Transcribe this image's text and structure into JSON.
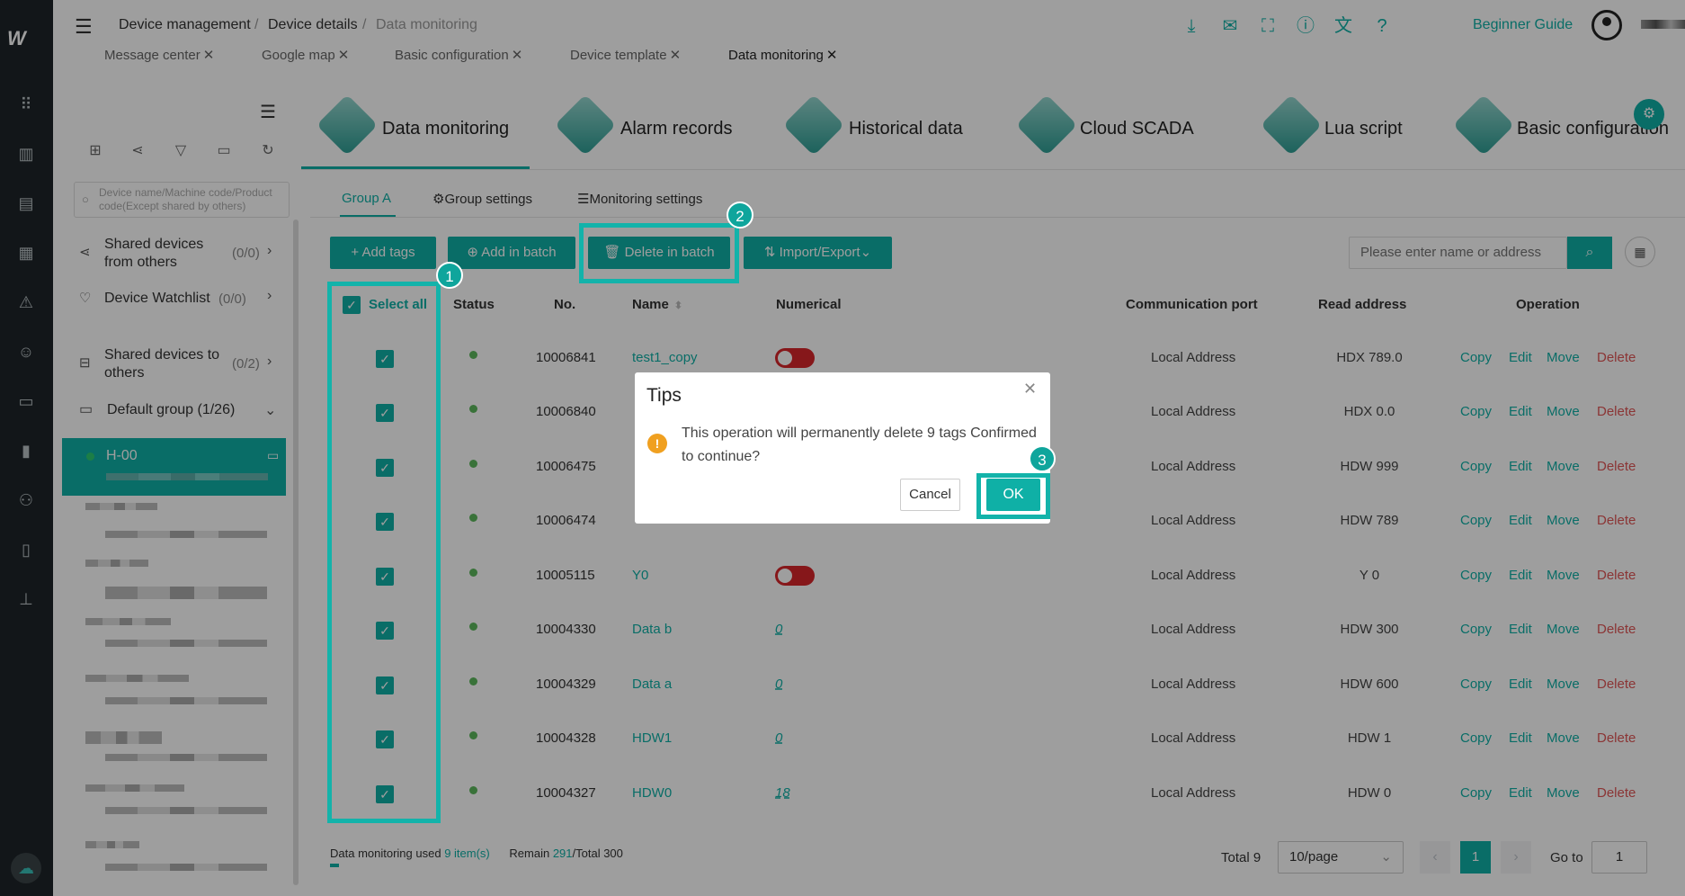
{
  "rail": {
    "logo": "W"
  },
  "breadcrumb": [
    "Device management",
    "Device details",
    "Data monitoring"
  ],
  "open_tabs": [
    "Message center",
    "Google map",
    "Basic configuration",
    "Device template",
    "Data monitoring"
  ],
  "header": {
    "guide": "Beginner Guide"
  },
  "sidebar": {
    "search_placeholder": "Device name/Machine code/Product code(Except shared by others)",
    "shared_from_label": "Shared devices from others",
    "shared_from_count": "(0/0)",
    "watchlist_label": "Device Watchlist",
    "watchlist_count": "(0/0)",
    "shared_to_label": "Shared devices to others",
    "shared_to_count": "(0/2)",
    "default_group": "Default group (1/26)",
    "selected_device": "H-00"
  },
  "main_tabs": [
    "Data monitoring",
    "Alarm records",
    "Historical data",
    "Cloud SCADA",
    "Lua script",
    "Basic configuration"
  ],
  "group_tabs": [
    "Group A",
    "Group settings",
    "Monitoring settings"
  ],
  "toolbar": {
    "add_tags": "Add tags",
    "add_batch": "Add in batch",
    "delete_batch": "Delete in batch",
    "import_export": "Import/Export",
    "search_placeholder": "Please enter name or address"
  },
  "table": {
    "select_all": "Select all",
    "headers": [
      "Status",
      "No.",
      "Name",
      "Numerical",
      "Communication port",
      "Read address",
      "Operation"
    ],
    "ops": [
      "Copy",
      "Edit",
      "Move",
      "Delete"
    ],
    "rows": [
      {
        "no": "10006841",
        "name": "test1_copy",
        "numeric": "toggle",
        "port": "Local Address",
        "addr": "HDX 789.0"
      },
      {
        "no": "10006840",
        "name": "",
        "numeric": "",
        "port": "Local Address",
        "addr": "HDX 0.0"
      },
      {
        "no": "10006475",
        "name": "",
        "numeric": "",
        "port": "Local Address",
        "addr": "HDW 999"
      },
      {
        "no": "10006474",
        "name": "",
        "numeric": "",
        "port": "Local Address",
        "addr": "HDW 789"
      },
      {
        "no": "10005115",
        "name": "Y0",
        "numeric": "toggle",
        "port": "Local Address",
        "addr": "Y 0"
      },
      {
        "no": "10004330",
        "name": "Data b",
        "numeric": "0",
        "port": "Local Address",
        "addr": "HDW 300"
      },
      {
        "no": "10004329",
        "name": "Data a",
        "numeric": "0",
        "port": "Local Address",
        "addr": "HDW 600"
      },
      {
        "no": "10004328",
        "name": "HDW1",
        "numeric": "0",
        "port": "Local Address",
        "addr": "HDW 1"
      },
      {
        "no": "10004327",
        "name": "HDW0",
        "numeric": "18",
        "port": "Local Address",
        "addr": "HDW 0"
      }
    ]
  },
  "footer": {
    "used_label": "Data monitoring used",
    "used_value": "9 item(s)",
    "remain_label": "Remain",
    "remain_value": "291",
    "total_label": "/Total 300",
    "total": "Total 9",
    "page_size": "10/page",
    "current_page": "1",
    "goto_label": "Go to",
    "goto_value": "1"
  },
  "dialog": {
    "title": "Tips",
    "message": "This operation will permanently delete 9 tags Confirmed to continue?",
    "cancel": "Cancel",
    "ok": "OK"
  },
  "annotations": [
    "1",
    "2",
    "3"
  ],
  "colors": {
    "accent": "#0fb0a6",
    "danger": "#e05656",
    "rail": "#1e2529"
  }
}
